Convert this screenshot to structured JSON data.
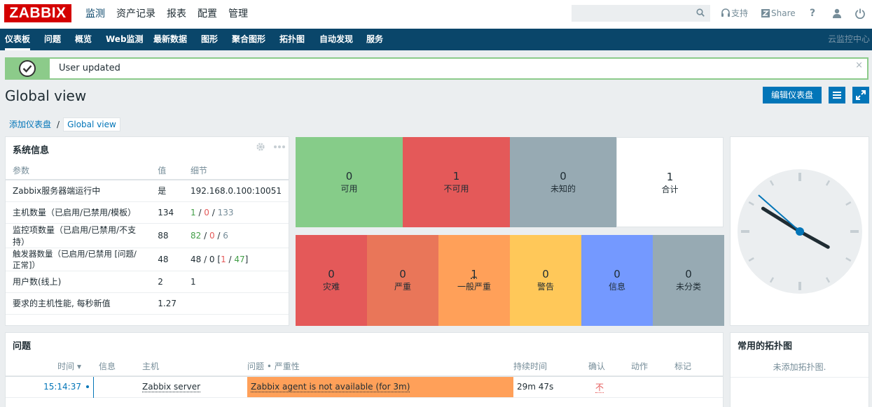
{
  "app": {
    "logo": "ZABBIX"
  },
  "topmenu": [
    "监测",
    "资产记录",
    "报表",
    "配置",
    "管理"
  ],
  "toplinks": {
    "support": "支持",
    "share": "Share",
    "help": "?"
  },
  "subnav": {
    "items": [
      "仪表板",
      "问题",
      "概览",
      "Web监测",
      "最新数据",
      "图形",
      "聚合图形",
      "拓扑图",
      "自动发现",
      "服务"
    ],
    "right": "云监控中心"
  },
  "message": {
    "text": "User updated",
    "close": "×"
  },
  "page": {
    "title": "Global view",
    "edit_label": "编辑仪表盘"
  },
  "breadcrumb": {
    "parent": "添加仪表盘",
    "separator": "/",
    "current": "Global view"
  },
  "sysinfo": {
    "title": "系统信息",
    "headers": [
      "参数",
      "值",
      "细节"
    ],
    "rows": [
      {
        "param": "Zabbix服务器端运行中",
        "value": "是",
        "d1": "192.168.0.100:10051",
        "d2": "",
        "d3": "",
        "d4": "",
        "d5": "",
        "d6": "",
        "d7": ""
      },
      {
        "param": "主机数量（已启用/已禁用/模板）",
        "value": "134",
        "d1": "",
        "d2": "1",
        "d3": " / ",
        "d4": "0",
        "d5": " / ",
        "d6": "133",
        "d7": ""
      },
      {
        "param": "监控项数量（已启用/已禁用/不支持）",
        "value": "88",
        "d1": "",
        "d2": "82",
        "d3": " / ",
        "d4": "0",
        "d5": " / ",
        "d6": "6",
        "d7": ""
      },
      {
        "param": "触发器数量（已启用/已禁用 [问题/正常]）",
        "value": "48",
        "d1": "48 / 0 [",
        "d2": "",
        "d3": "",
        "d4": "1",
        "d5": " / ",
        "d6": "",
        "d7": "47"
      },
      {
        "param": "用户数(线上)",
        "value": "2",
        "d1": "",
        "d2": "1",
        "d3": "",
        "d4": "",
        "d5": "",
        "d6": "",
        "d7": ""
      },
      {
        "param": "要求的主机性能, 每秒新值",
        "value": "1.27",
        "d1": "",
        "d2": "",
        "d3": "",
        "d4": "",
        "d5": "",
        "d6": "",
        "d7": ""
      }
    ],
    "trigger_close": "]"
  },
  "host_status": [
    {
      "count": "0",
      "label": "可用",
      "color": "#86cc89"
    },
    {
      "count": "1",
      "label": "不可用",
      "color": "#e45959"
    },
    {
      "count": "0",
      "label": "未知的",
      "color": "#97aab3"
    },
    {
      "count": "1",
      "label": "合计",
      "color": "#ffffff"
    }
  ],
  "severity": [
    {
      "count": "0",
      "label": "灾难",
      "color": "#e45959"
    },
    {
      "count": "0",
      "label": "严重",
      "color": "#e97659"
    },
    {
      "count": "1",
      "label": "一般严重",
      "color": "#ffa059"
    },
    {
      "count": "0",
      "label": "警告",
      "color": "#ffc859"
    },
    {
      "count": "0",
      "label": "信息",
      "color": "#7499ff"
    },
    {
      "count": "0",
      "label": "未分类",
      "color": "#97aab3"
    }
  ],
  "clock": {
    "hour_angle": 119,
    "minute_angle": 302
  },
  "problems": {
    "title": "问题",
    "headers": [
      "时间 ▾",
      "信息",
      "主机",
      "问题 • 严重性",
      "持续时间",
      "确认",
      "动作",
      "标记"
    ],
    "rows": [
      {
        "time": "15:14:37",
        "host": "Zabbix server",
        "problem": "Zabbix agent is not available (for 3m)",
        "duration": "29m 47s",
        "ack": "不"
      }
    ]
  },
  "maps": {
    "title": "常用的拓扑图",
    "empty": "未添加拓扑图."
  }
}
